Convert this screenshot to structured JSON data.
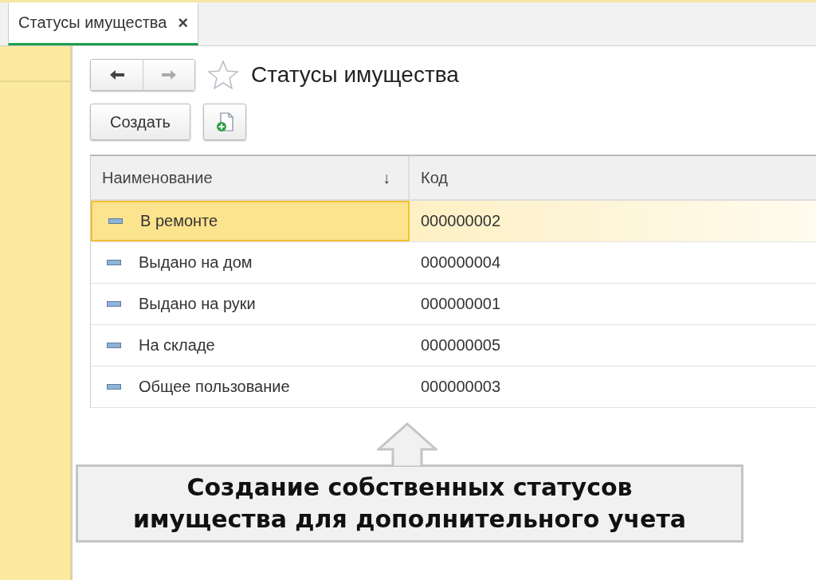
{
  "tabs": [
    {
      "label": "Статусы имущества",
      "close": "×",
      "selected": true
    }
  ],
  "page": {
    "title": "Статусы имущества",
    "favorite": false
  },
  "toolbar": {
    "create_button": "Создать"
  },
  "table": {
    "columns": [
      {
        "label": "Наименование",
        "sort": "↓"
      },
      {
        "label": "Код"
      }
    ],
    "rows": [
      {
        "name": "В ремонте",
        "code": "000000002",
        "selected": true
      },
      {
        "name": "Выдано на дом",
        "code": "000000004",
        "selected": false
      },
      {
        "name": "Выдано на руки",
        "code": "000000001",
        "selected": false
      },
      {
        "name": "На складе",
        "code": "000000005",
        "selected": false
      },
      {
        "name": "Общее пользование",
        "code": "000000003",
        "selected": false
      }
    ]
  },
  "callout": {
    "text": "Создание собственных статусов имущества для дополнительного учета"
  }
}
